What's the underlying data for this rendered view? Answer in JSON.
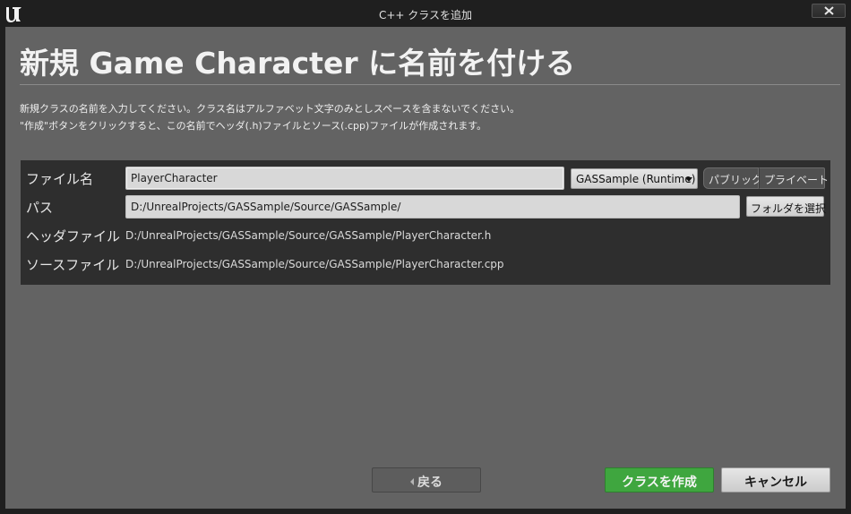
{
  "window": {
    "title": "C++ クラスを追加",
    "logo": "unreal-engine-logo",
    "close_icon": "close-x-icon"
  },
  "header": {
    "title": "新規 Game Character に名前を付ける",
    "description_line1": "新規クラスの名前を入力してください。クラス名はアルファベット文字のみとしスペースを含まないでください。",
    "description_line2": "\"作成\"ボタンをクリックすると、この名前でヘッダ(.h)ファイルとソース(.cpp)ファイルが作成されます。"
  },
  "form": {
    "name_label": "ファイル名",
    "name_value": "PlayerCharacter",
    "module_dropdown": "GASSample (Runtime)",
    "visibility_public": "パブリック",
    "visibility_private": "プライベート",
    "path_label": "パス",
    "path_value": "D:/UnrealProjects/GASSample/Source/GASSample/",
    "choose_folder_button": "フォルダを選択",
    "header_file_label": "ヘッダファイル",
    "header_file_value": "D:/UnrealProjects/GASSample/Source/GASSample/PlayerCharacter.h",
    "source_file_label": "ソースファイル",
    "source_file_value": "D:/UnrealProjects/GASSample/Source/GASSample/PlayerCharacter.cpp"
  },
  "footer": {
    "back_button": "戻る",
    "create_button": "クラスを作成",
    "cancel_button": "キャンセル"
  },
  "colors": {
    "create_accent": "#3fa63f",
    "body_bg": "#636363",
    "panel_bg": "#2e2e2e"
  }
}
